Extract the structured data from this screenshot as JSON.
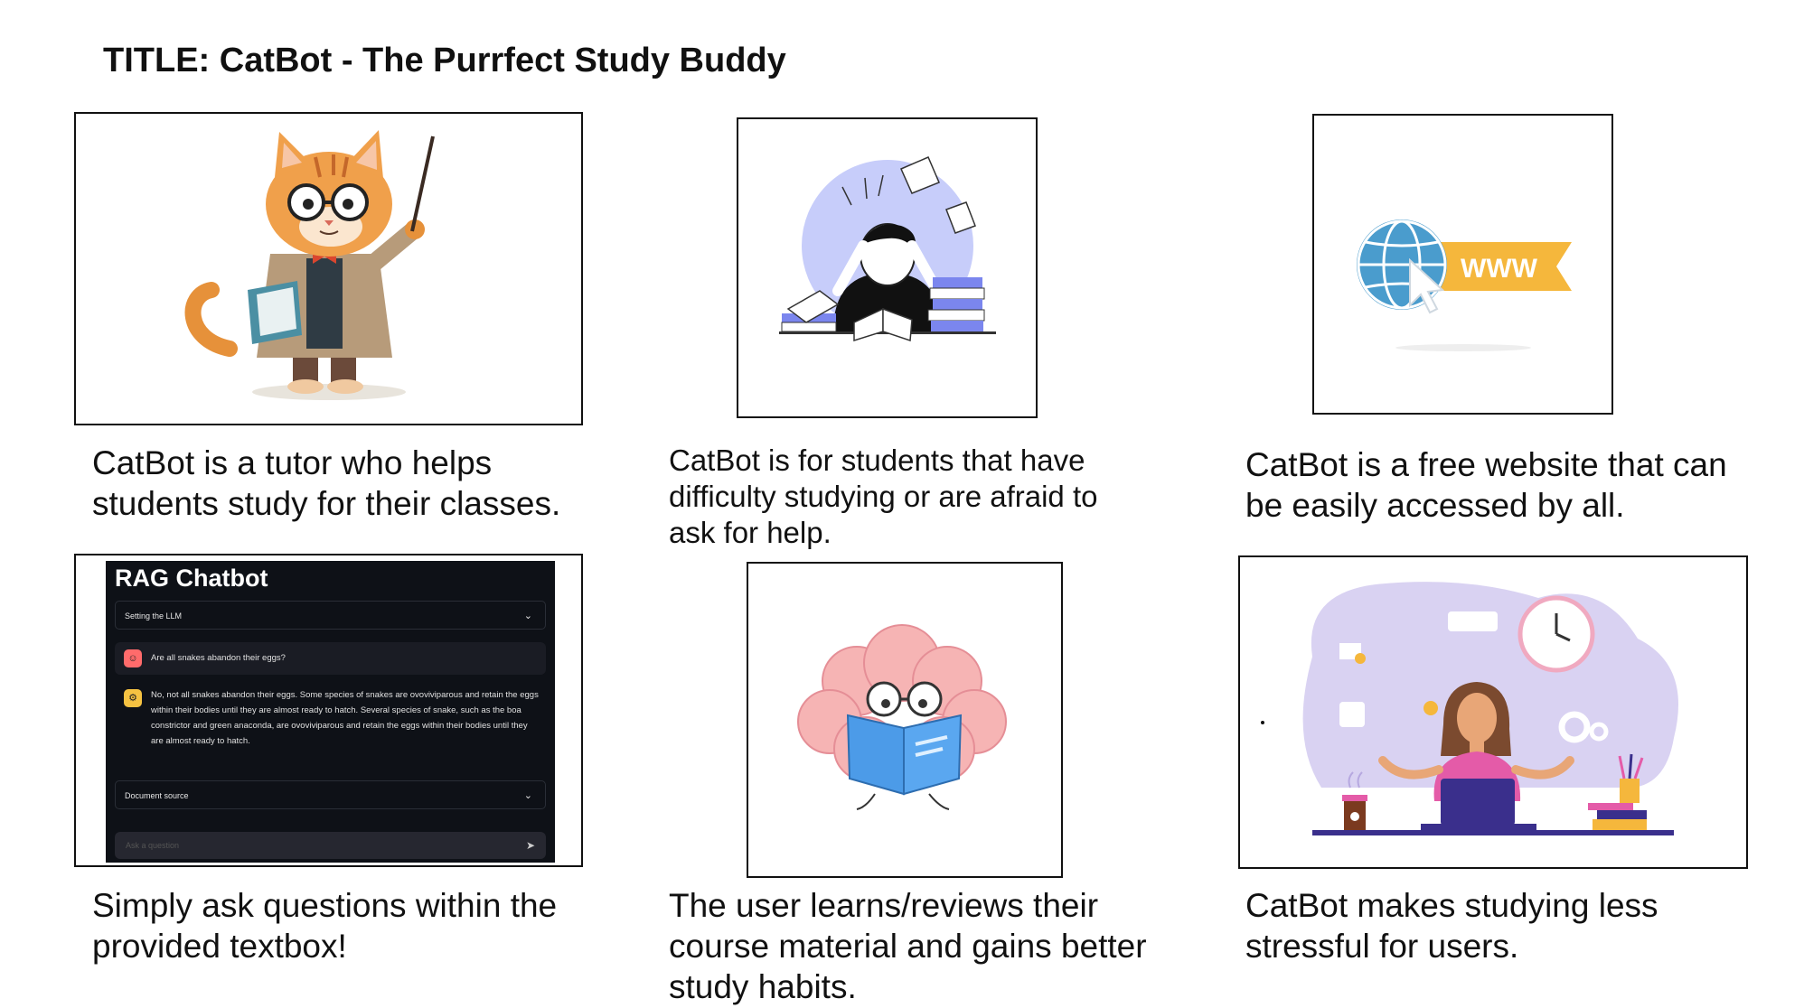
{
  "title": "TITLE: CatBot - The Purrfect Study Buddy",
  "panels": [
    {
      "caption": "CatBot is a tutor who helps students study for their classes."
    },
    {
      "caption": "CatBot is for students that have difficulty studying or are afraid to ask for help."
    },
    {
      "caption": "CatBot is a free website that can be easily accessed by all."
    },
    {
      "caption": "Simply ask questions within the provided textbox!"
    },
    {
      "caption": "The user learns/reviews their course material and gains better study habits."
    },
    {
      "caption": "CatBot makes studying less stressful for users."
    }
  ],
  "www_label": "WWW",
  "chatbot": {
    "title": "RAG Chatbot",
    "expander_llm": "Setting the LLM",
    "question": "Are all snakes abandon their eggs?",
    "answer": "No, not all snakes abandon their eggs. Some species of snakes are ovoviviparous and retain the eggs within their bodies until they are almost ready to hatch. Several species of snake, such as the boa constrictor and green anaconda, are ovoviviparous and retain the eggs within their bodies until they are almost ready to hatch.",
    "expander_source": "Document source",
    "input_placeholder": "Ask a question"
  },
  "colors": {
    "accent_blue": "#4a8fd6",
    "www_yellow": "#f5b73c",
    "chat_bg": "#0e1117"
  }
}
